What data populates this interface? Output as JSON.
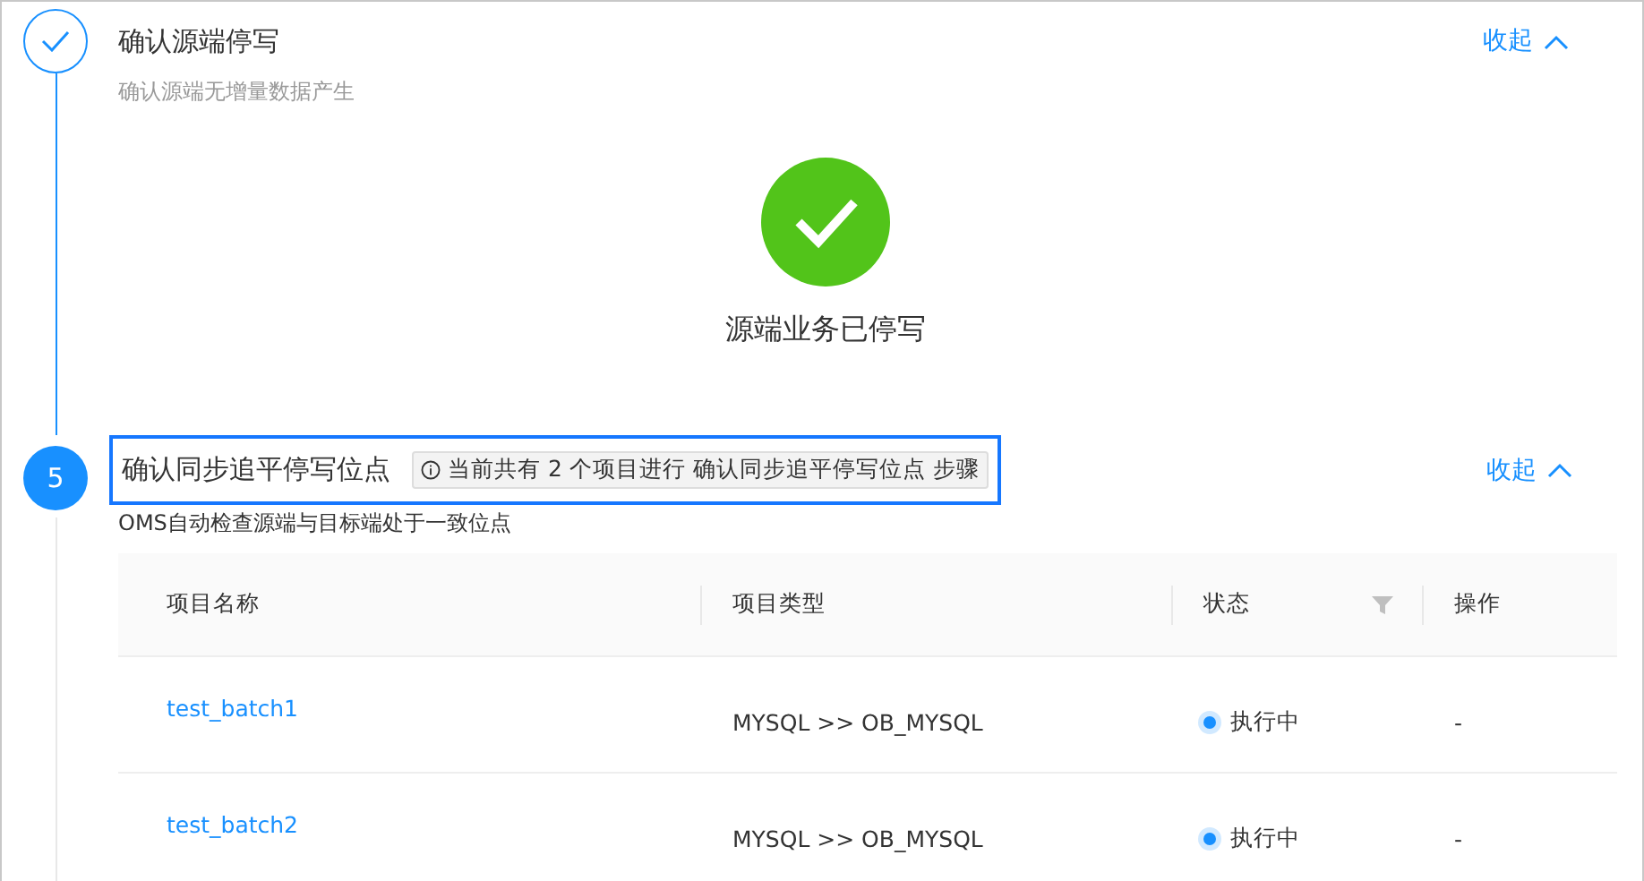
{
  "steps": [
    {
      "kind": "done",
      "title": "确认源端停写",
      "subtitle": "确认源端无增量数据产生",
      "collapse": "收起",
      "result": {
        "text": "源端业务已停写"
      }
    },
    {
      "kind": "number",
      "number": "5",
      "title": "确认同步追平停写位点",
      "focused": true,
      "notice": "当前共有 2 个项目进行 确认同步追平停写位点 步骤",
      "subtitle": "OMS自动检查源端与目标端处于一致位点",
      "collapse": "收起",
      "table": {
        "columns": [
          {
            "label": "项目名称"
          },
          {
            "label": "项目类型"
          },
          {
            "label": "状态",
            "filter": true
          },
          {
            "label": "操作"
          }
        ],
        "rows": [
          {
            "name": "test_batch1",
            "type": "MYSQL >> OB_MYSQL",
            "status": "执行中",
            "color": "#1890ff",
            "action": "-"
          },
          {
            "name": "test_batch2",
            "type": "MYSQL >> OB_MYSQL",
            "status": "执行中",
            "color": "#1890ff",
            "action": "-"
          }
        ]
      }
    }
  ]
}
